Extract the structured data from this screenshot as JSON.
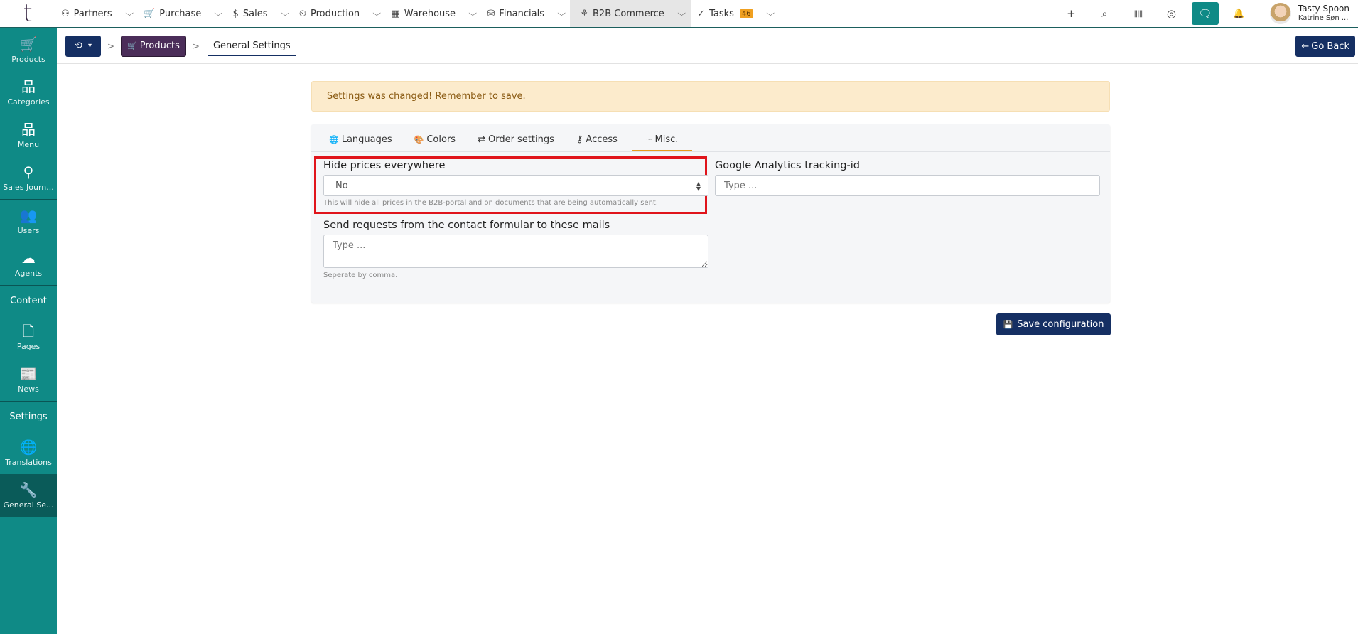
{
  "topbar": {
    "logo": "t",
    "nav": [
      {
        "label": "Partners",
        "icon": "handshake-icon",
        "glyph": "⚇"
      },
      {
        "label": "Purchase",
        "icon": "cart-icon",
        "glyph": "🛒"
      },
      {
        "label": "Sales",
        "icon": "sales-icon",
        "glyph": "$"
      },
      {
        "label": "Production",
        "icon": "production-icon",
        "glyph": "⏲"
      },
      {
        "label": "Warehouse",
        "icon": "warehouse-icon",
        "glyph": "▦"
      },
      {
        "label": "Financials",
        "icon": "coins-icon",
        "glyph": "⛁"
      },
      {
        "label": "B2B Commerce",
        "icon": "b2b-icon",
        "glyph": "⚘"
      },
      {
        "label": "Tasks",
        "icon": "check-icon",
        "glyph": "✓",
        "badge": "46"
      }
    ],
    "chevron": "⌵",
    "actions": {
      "add": "+",
      "search": "⌕",
      "barcode": "|||||",
      "help": "◎",
      "chat": "🗨",
      "bell": "🔔"
    },
    "user": {
      "name": "Tasty Spoon",
      "sub": "Katrine Søn ..."
    }
  },
  "sidebar": {
    "items": [
      {
        "label": "Products",
        "glyph": "🛒"
      },
      {
        "label": "Categories",
        "glyph": "品"
      },
      {
        "label": "Menu",
        "glyph": "品"
      },
      {
        "label": "Sales Journ...",
        "glyph": "⚲"
      },
      {
        "label": "Users",
        "glyph": "👥"
      },
      {
        "label": "Agents",
        "glyph": "☁"
      }
    ],
    "content_heading": "Content",
    "content_items": [
      {
        "label": "Pages",
        "glyph": "🗋"
      },
      {
        "label": "News",
        "glyph": "📰"
      }
    ],
    "settings_heading": "Settings",
    "settings_items": [
      {
        "label": "Translations",
        "glyph": "🌐"
      },
      {
        "label": "General Se...",
        "glyph": "🔧"
      }
    ]
  },
  "breadcrumb": {
    "history_glyph": "⟲",
    "caret": "▾",
    "sep": ">",
    "products": "Products",
    "products_glyph": "🛒",
    "current": "General Settings",
    "go_back": "Go Back",
    "go_back_glyph": "←"
  },
  "alert": {
    "text": "Settings was changed! Remember to save."
  },
  "tabs": [
    {
      "label": "Languages",
      "glyph": "🌐"
    },
    {
      "label": "Colors",
      "glyph": "🎨"
    },
    {
      "label": "Order settings",
      "glyph": "⇄"
    },
    {
      "label": "Access",
      "glyph": "⚷"
    },
    {
      "label": "Misc.",
      "glyph": "···",
      "active": true
    }
  ],
  "form": {
    "hide_prices": {
      "label": "Hide prices everywhere",
      "value": "No",
      "help": "This will hide all prices in the B2B-portal and on documents that are being automatically sent."
    },
    "ga": {
      "label": "Google Analytics tracking-id",
      "placeholder": "Type ..."
    },
    "contact_mails": {
      "label": "Send requests from the contact formular to these mails",
      "placeholder": "Type ...",
      "help": "Seperate by comma."
    }
  },
  "save_button": {
    "label": "Save configuration",
    "glyph": "💾"
  },
  "colors": {
    "primary": "#152f63",
    "sidebar": "#0f8a86",
    "accent": "#e89a1c",
    "highlight": "#e0141b"
  }
}
